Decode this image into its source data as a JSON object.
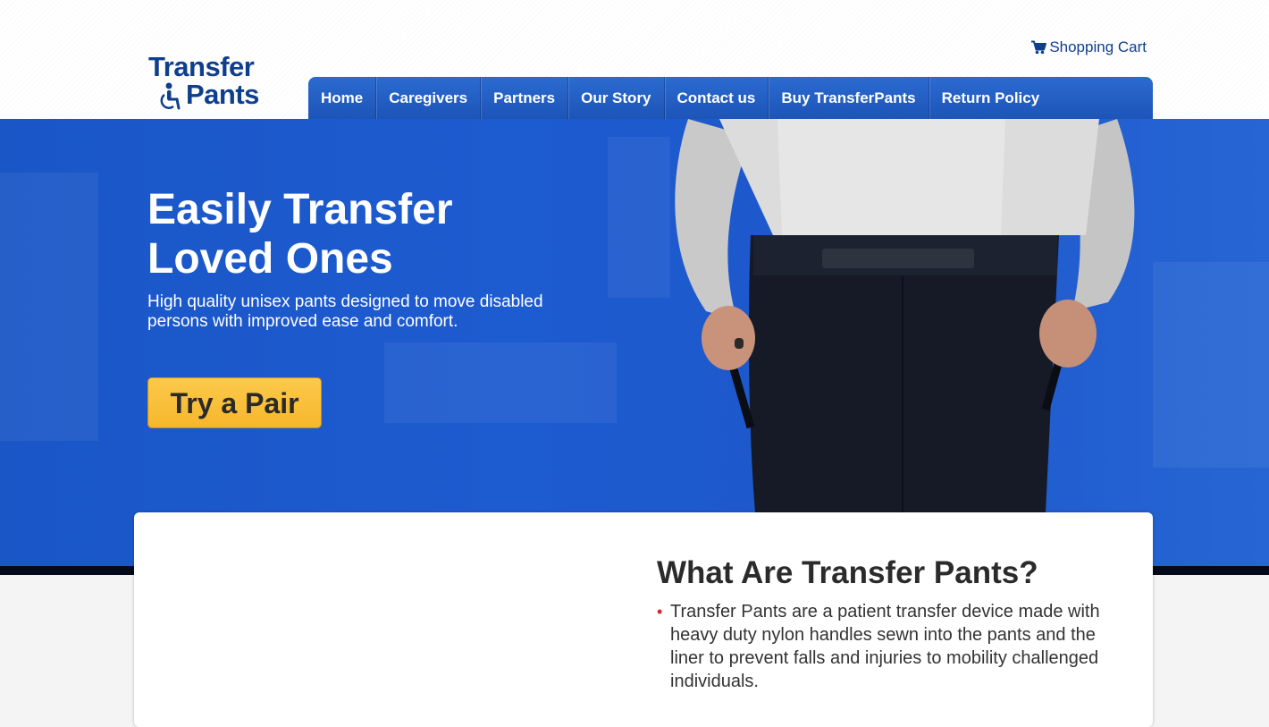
{
  "brand": {
    "logo_line1": "Transfer",
    "logo_line2": "Pants"
  },
  "header": {
    "cart_label": "Shopping Cart"
  },
  "nav": {
    "items": [
      {
        "label": "Home"
      },
      {
        "label": "Caregivers"
      },
      {
        "label": "Partners"
      },
      {
        "label": "Our Story"
      },
      {
        "label": "Contact us"
      },
      {
        "label": "Buy TransferPants"
      },
      {
        "label": "Return Policy"
      }
    ]
  },
  "hero": {
    "title_line1": "Easily Transfer",
    "title_line2": "Loved Ones",
    "subtitle": "High quality unisex pants designed to move disabled persons with improved ease and comfort.",
    "cta_label": "Try a Pair"
  },
  "content": {
    "section_title": "What Are Transfer Pants?",
    "items": [
      {
        "text": "Transfer Pants are a patient transfer device made with heavy duty nylon handles sewn into the pants and the liner to prevent falls and injuries to mobility challenged individuals."
      }
    ]
  },
  "colors": {
    "brand_blue": "#0e3f8f",
    "nav_blue": "#2b6bd0",
    "hero_blue": "#1d5bd0",
    "cta_yellow": "#f6b72d",
    "bullet_red": "#d8262b"
  },
  "icons": {
    "logo": "wheelchair-icon",
    "cart": "shopping-cart-icon"
  }
}
